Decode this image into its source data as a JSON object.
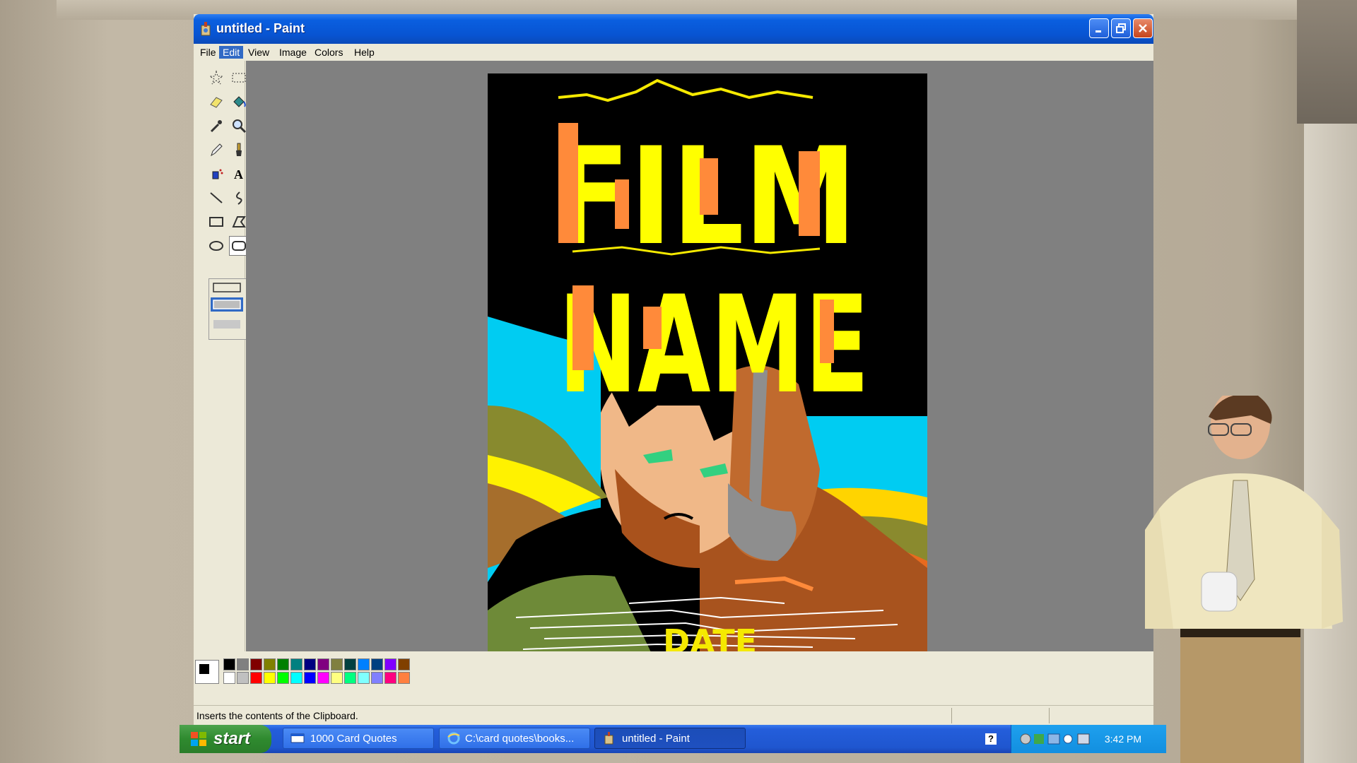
{
  "window": {
    "title": "untitled - Paint"
  },
  "menu": {
    "items": [
      "File",
      "Edit",
      "View",
      "Image",
      "Colors",
      "Help"
    ],
    "active": "Edit"
  },
  "canvas": {
    "title_line1": "FILM",
    "title_line2": "NAME",
    "date_text": "DATE"
  },
  "palette": {
    "foreground": "#000000",
    "background": "#ffffff",
    "top_row": [
      "#000000",
      "#808080",
      "#800000",
      "#808000",
      "#008000",
      "#008080",
      "#000080",
      "#800080",
      "#808040",
      "#004040",
      "#0080ff",
      "#004080",
      "#8000ff",
      "#804000"
    ],
    "bottom_row": [
      "#ffffff",
      "#c0c0c0",
      "#ff0000",
      "#ffff00",
      "#00ff00",
      "#00ffff",
      "#0000ff",
      "#ff00ff",
      "#ffff80",
      "#00ff80",
      "#80ffff",
      "#8080ff",
      "#ff0080",
      "#ff8040"
    ]
  },
  "status": {
    "text": "Inserts the contents of the Clipboard."
  },
  "taskbar": {
    "start_label": "start",
    "tasks": [
      "1000 Card Quotes",
      "C:\\card quotes\\books...",
      "untitled - Paint"
    ],
    "help_glyph": "?",
    "clock": "3:42 PM"
  }
}
